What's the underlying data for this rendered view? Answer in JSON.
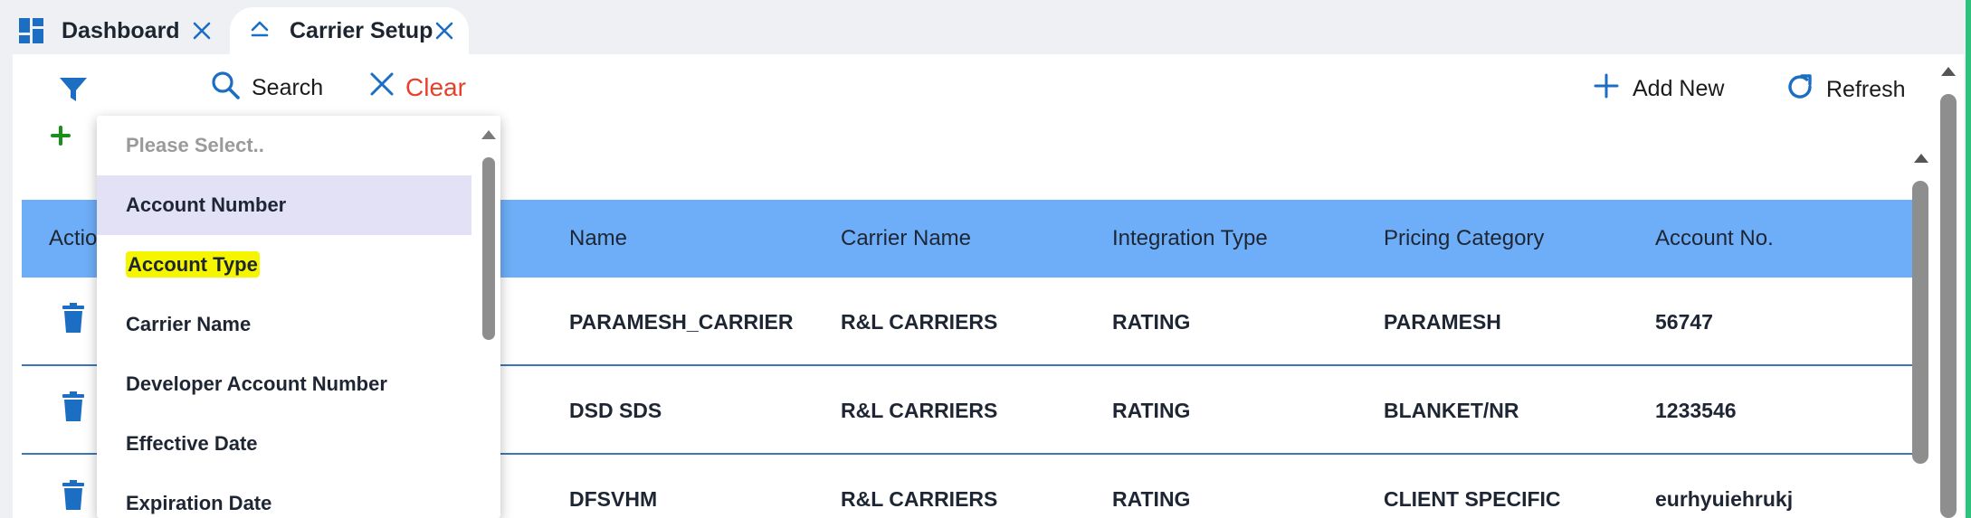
{
  "tabs": [
    {
      "label": "Dashboard",
      "icon": "dashboard-grid-icon"
    },
    {
      "label": "Carrier Setup",
      "icon": "eject-icon"
    }
  ],
  "toolbar": {
    "search_label": "Search",
    "clear_label": "Clear",
    "add_new_label": "Add New",
    "refresh_label": "Refresh"
  },
  "grid": {
    "columns": [
      "Actio",
      "Name",
      "Carrier Name",
      "Integration Type",
      "Pricing Category",
      "Account No."
    ],
    "rows": [
      {
        "name": "PARAMESH_CARRIER",
        "carrier_name": "R&L CARRIERS",
        "integration_type": "RATING",
        "pricing_category": "PARAMESH",
        "account_no": "56747"
      },
      {
        "name": "DSD SDS",
        "carrier_name": "R&L CARRIERS",
        "integration_type": "RATING",
        "pricing_category": "BLANKET/NR",
        "account_no": "1233546"
      },
      {
        "name": "DFSVHM",
        "carrier_name": "R&L CARRIERS",
        "integration_type": "RATING",
        "pricing_category": "CLIENT SPECIFIC",
        "account_no": "eurhyuiehrukj"
      }
    ]
  },
  "dropdown": {
    "placeholder": "Please Select..",
    "options": [
      "Account Number",
      "Account Type",
      "Carrier Name",
      "Developer Account Number",
      "Effective Date",
      "Expiration Date"
    ],
    "active_option": "Account Number",
    "highlighted_option": "Account Type"
  },
  "colors": {
    "accent": "#1b6ec2",
    "header_bg": "#6eaef8",
    "clear": "#e5412c",
    "add_green": "#1a8f1a",
    "highlight": "#f5f500"
  }
}
